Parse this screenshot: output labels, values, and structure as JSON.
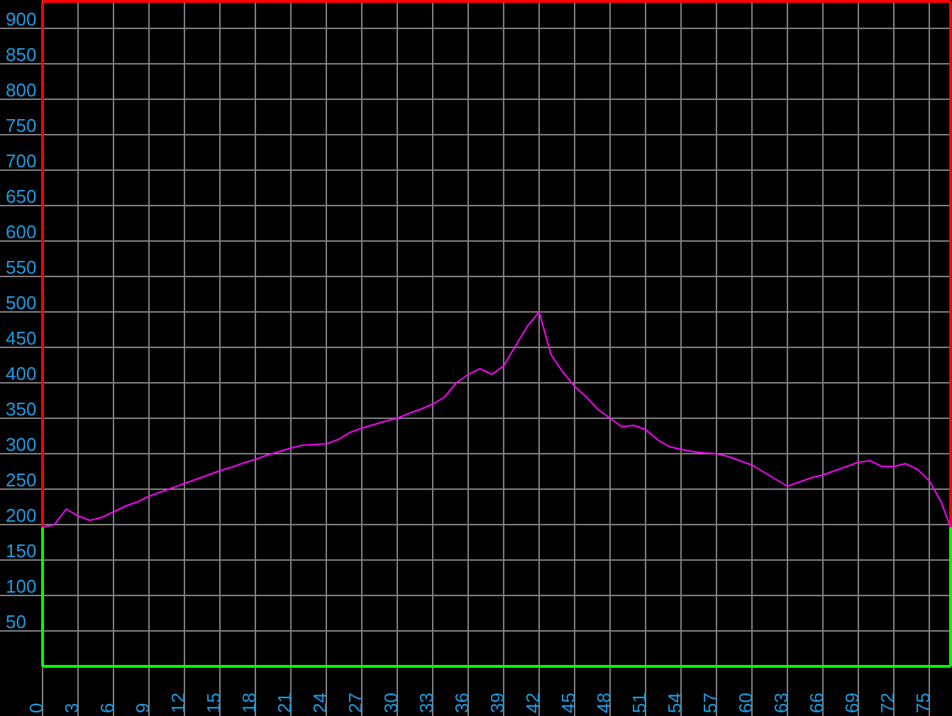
{
  "chart_data": {
    "type": "line",
    "x": [
      0,
      1,
      2,
      3,
      4,
      5,
      6,
      7,
      8,
      9,
      10,
      11,
      12,
      13,
      14,
      15,
      16,
      17,
      18,
      19,
      20,
      21,
      22,
      23,
      24,
      25,
      26,
      27,
      28,
      29,
      30,
      31,
      32,
      33,
      34,
      35,
      36,
      37,
      38,
      39,
      40,
      41,
      42,
      43,
      44,
      45,
      46,
      47,
      48,
      49,
      50,
      51,
      52,
      53,
      54,
      55,
      56,
      57,
      58,
      59,
      60,
      61,
      62,
      63,
      64,
      65,
      66,
      67,
      68,
      69,
      70,
      71,
      72,
      73,
      74,
      75,
      76,
      76.8
    ],
    "series": [
      {
        "color": "#ff00ff",
        "values": [
          196,
          200,
          222,
          212,
          206,
          210,
          218,
          226,
          232,
          240,
          246,
          252,
          258,
          264,
          270,
          276,
          281,
          287,
          292,
          298,
          303,
          308,
          312,
          313,
          314,
          320,
          330,
          336,
          341,
          346,
          350,
          357,
          363,
          370,
          380,
          400,
          412,
          420,
          412,
          424,
          452,
          480,
          500,
          440,
          415,
          395,
          380,
          362,
          350,
          338,
          340,
          334,
          320,
          310,
          306,
          303,
          301,
          300,
          296,
          290,
          284,
          274,
          264,
          254,
          260,
          266,
          270,
          276,
          282,
          288,
          290,
          282,
          282,
          286,
          278,
          262,
          232,
          196
        ]
      }
    ],
    "xlim": [
      0,
      76.8
    ],
    "ylim": [
      0,
      940
    ],
    "xticks": [
      0,
      3,
      6,
      9,
      12,
      15,
      18,
      21,
      24,
      27,
      30,
      33,
      36,
      39,
      42,
      45,
      48,
      51,
      54,
      57,
      60,
      63,
      66,
      69,
      72,
      75
    ],
    "yticks": [
      50,
      100,
      150,
      200,
      250,
      300,
      350,
      400,
      450,
      500,
      550,
      600,
      650,
      700,
      750,
      800,
      850,
      900
    ],
    "grid": true
  }
}
